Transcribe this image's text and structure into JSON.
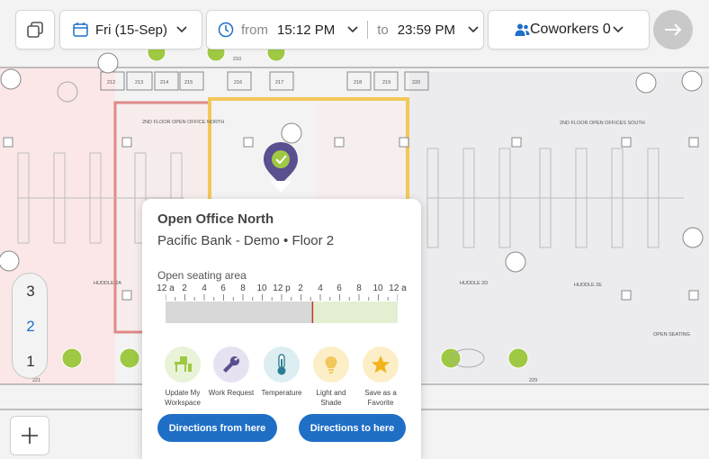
{
  "toolbar": {
    "date_label": "Fri (15-Sep)",
    "from_label": "from",
    "from_time": "15:12 PM",
    "to_label": "to",
    "to_time": "23:59 PM",
    "coworkers_label": "Coworkers 0"
  },
  "map": {
    "area_labels": {
      "north": "2ND FLOOR OPEN OFFICE NORTH",
      "south": "2ND FLOOR OPEN OFFICES SOUTH",
      "huddle_2a": "HUDDLE 2A",
      "huddle_2d": "HUDDLE 2D",
      "huddle_2e": "HUDDLE 2E",
      "open_seating": "OPEN SEATING"
    },
    "room_numbers": [
      "212",
      "213",
      "214",
      "215",
      "216",
      "217",
      "210",
      "218",
      "219",
      "220",
      "221",
      "229"
    ]
  },
  "floors": [
    "3",
    "2",
    "1"
  ],
  "selected_floor": "2",
  "popup": {
    "title": "Open Office North",
    "subtitle": "Pacific Bank - Demo • Floor 2",
    "seating_label": "Open seating area",
    "hour_labels": [
      "12 a",
      "2",
      "4",
      "6",
      "8",
      "10",
      "12 p",
      "2",
      "4",
      "6",
      "8",
      "10",
      "12 a"
    ],
    "actions": [
      {
        "label": "Update My Workspace",
        "icon": "workspace-icon"
      },
      {
        "label": "Work Request",
        "icon": "wrench-icon"
      },
      {
        "label": "Temperature",
        "icon": "thermometer-icon"
      },
      {
        "label": "Light and Shade",
        "icon": "lightbulb-icon"
      },
      {
        "label": "Save as a Favorite",
        "icon": "star-icon"
      }
    ],
    "directions_from": "Directions from here",
    "directions_to": "Directions to here"
  },
  "timeline": {
    "current_time_hours": 15.2
  }
}
